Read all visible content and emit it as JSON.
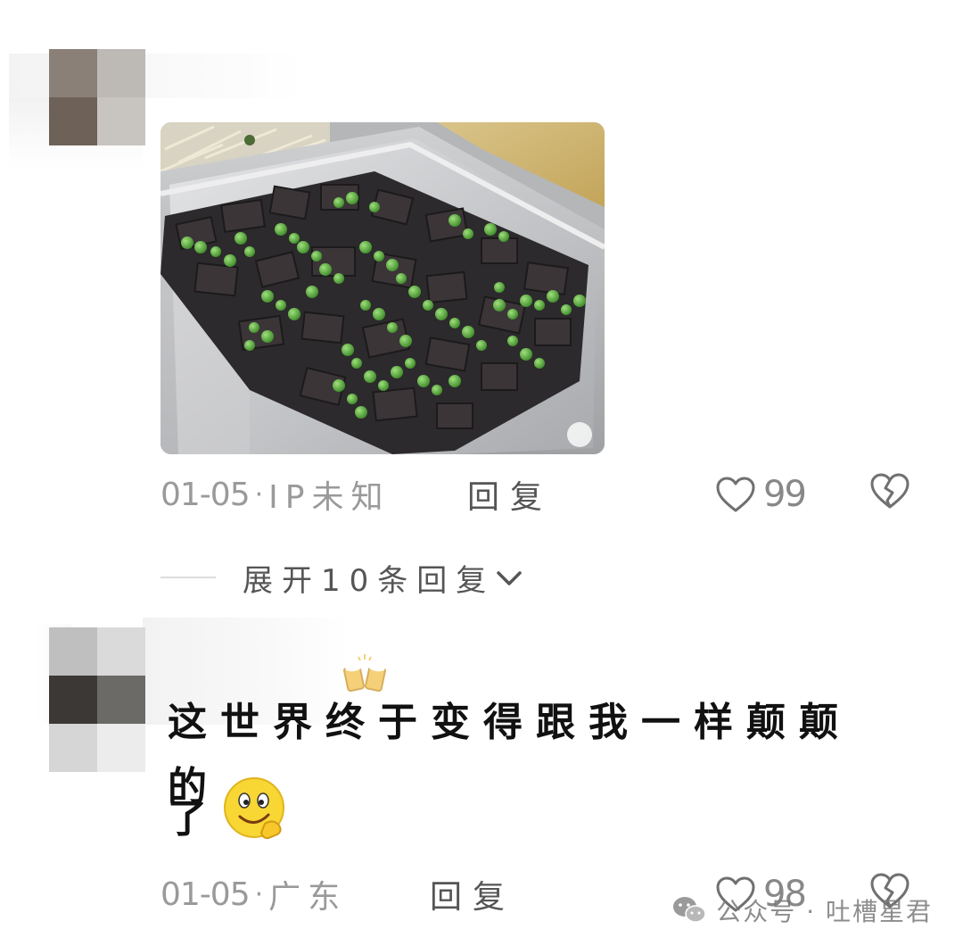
{
  "comments": [
    {
      "date": "01-05",
      "separator": "·",
      "location": "IP未知",
      "reply_label": "回复",
      "likes": "99",
      "expand": {
        "label": "展开10条回复"
      }
    },
    {
      "text_line1": "这世界终于变得跟我一样颠颠的",
      "text_line2": "了",
      "date": "01-05",
      "separator": "·",
      "location": "广东",
      "reply_label": "回复",
      "likes": "98"
    }
  ],
  "watermark": {
    "text": "公众号 · 吐槽星君",
    "icon": "wechat-icon"
  },
  "icons": {
    "like": "heart-outline-icon",
    "dislike": "broken-heart-icon",
    "expand": "chevron-down-icon",
    "emoji_beer": "beer-cheers-emoji",
    "emoji_smile": "smile-thumbs-emoji"
  },
  "colors": {
    "meta_text": "#9a9a9a",
    "reply_text": "#555555",
    "body_text": "#111111"
  }
}
